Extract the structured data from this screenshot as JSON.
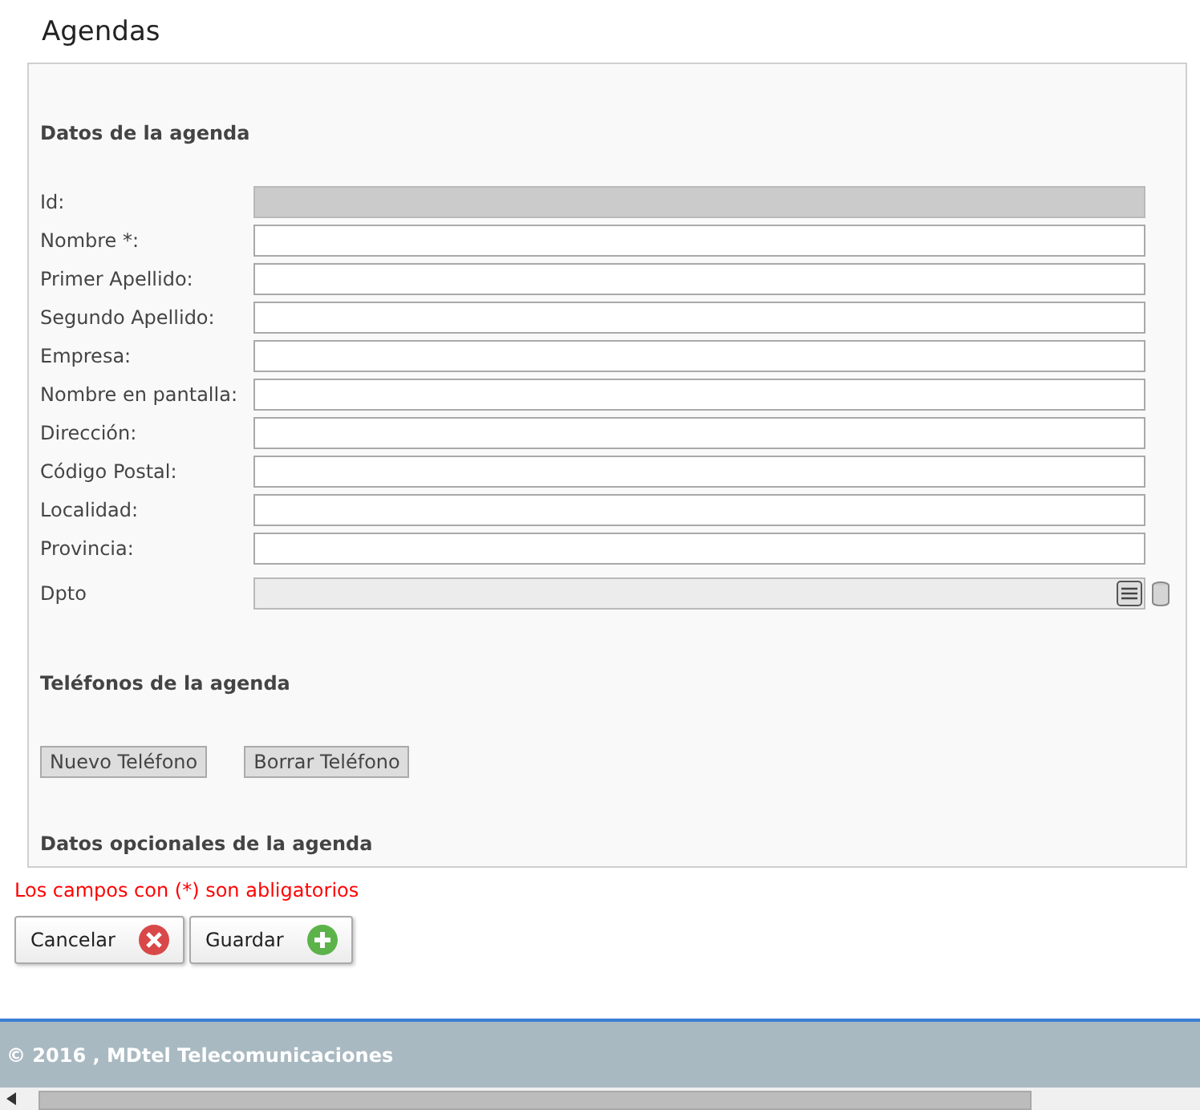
{
  "page_title": "Agendas",
  "sections": [
    {
      "title": "Datos de la agenda",
      "kind": "form",
      "fields": [
        {
          "label": "Id:",
          "disabled": true
        },
        {
          "label": "Nombre *:",
          "disabled": false
        },
        {
          "label": "Primer Apellido:",
          "disabled": false
        },
        {
          "label": "Segundo Apellido:",
          "disabled": false
        },
        {
          "label": "Empresa:",
          "disabled": false
        },
        {
          "label": "Nombre en pantalla:",
          "disabled": false
        },
        {
          "label": "Dirección:",
          "disabled": false
        },
        {
          "label": "Código Postal:",
          "disabled": false
        },
        {
          "label": "Localidad:",
          "disabled": false
        },
        {
          "label": "Provincia:",
          "disabled": false
        },
        {
          "label": "Dpto",
          "disabled": true,
          "kind": "lookup"
        }
      ]
    },
    {
      "title": "Teléfonos de la agenda",
      "kind": "buttons",
      "buttons": [
        "Nuevo Teléfono",
        "Borrar Teléfono"
      ]
    },
    {
      "title": "Datos opcionales de la agenda",
      "kind": "empty"
    }
  ],
  "required_note": "Los campos con (*) son abligatorios",
  "actions": [
    {
      "label": "Cancelar",
      "kind": "cancel"
    },
    {
      "label": "Guardar",
      "kind": "save"
    }
  ],
  "footer": "© 2016 , MDtel Telecomunicaciones"
}
